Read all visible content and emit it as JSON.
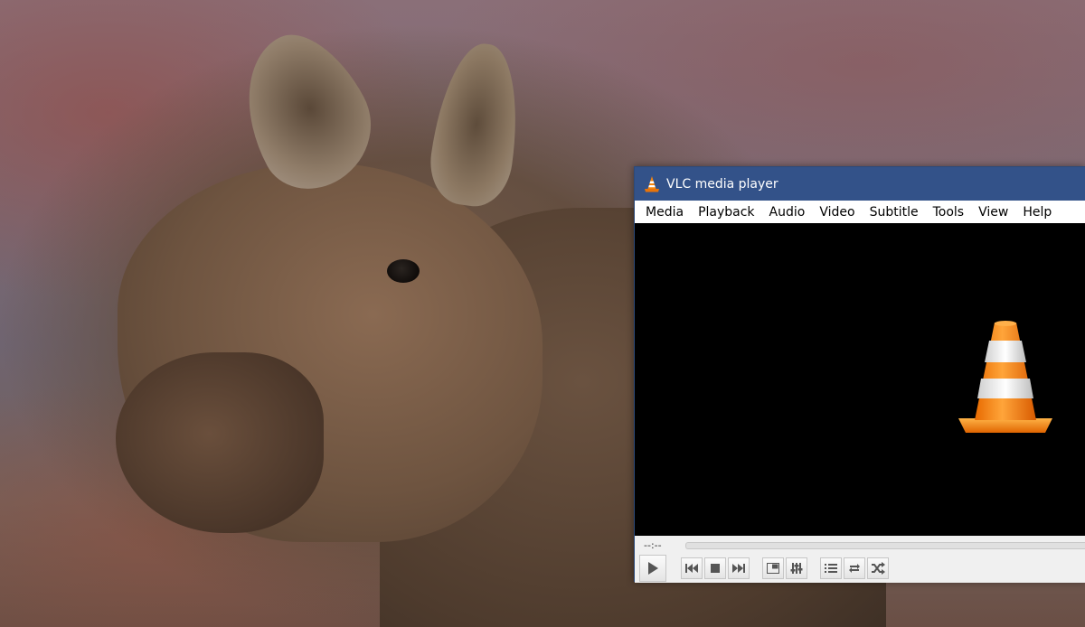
{
  "window": {
    "title": "VLC media player"
  },
  "menu": [
    "Media",
    "Playback",
    "Audio",
    "Video",
    "Subtitle",
    "Tools",
    "View",
    "Help"
  ],
  "playback": {
    "elapsed_time": "--:--"
  },
  "controls": [
    {
      "name": "play",
      "icon": "play-icon"
    },
    {
      "name": "previous",
      "icon": "skip-previous-icon"
    },
    {
      "name": "stop",
      "icon": "stop-icon"
    },
    {
      "name": "next",
      "icon": "skip-next-icon"
    },
    {
      "name": "fullscreen",
      "icon": "fullscreen-icon"
    },
    {
      "name": "extended-settings",
      "icon": "equalizer-icon"
    },
    {
      "name": "playlist",
      "icon": "playlist-icon"
    },
    {
      "name": "loop",
      "icon": "loop-icon"
    },
    {
      "name": "shuffle",
      "icon": "shuffle-icon"
    }
  ],
  "colors": {
    "titlebar": "#335289",
    "video_background": "#000000",
    "cone_orange": "#f5860f"
  }
}
